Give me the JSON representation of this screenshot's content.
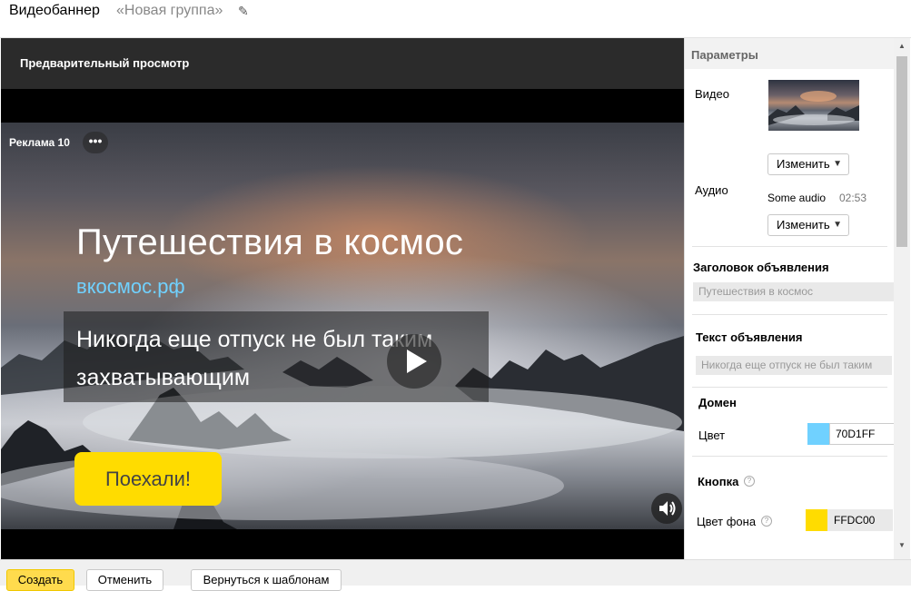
{
  "header": {
    "title": "Видеобаннер",
    "group": "«Новая группа»"
  },
  "preview": {
    "label": "Предварительный просмотр",
    "ad_label": "Реклама 10",
    "dots": "•••",
    "headline": "Путешествия в космос",
    "domain": "вкосмос.рф",
    "body": "Никогда еще отпуск не был таким захватывающим",
    "cta": "Поехали!"
  },
  "panel": {
    "title": "Параметры",
    "video_label": "Видео",
    "change_label": "Изменить",
    "audio_label": "Аудио",
    "audio_name": "Some audio",
    "audio_time": "02:53",
    "headline_label": "Заголовок объявления",
    "headline_value": "Путешествия в космос",
    "text_label": "Текст объявления",
    "text_value": "Никогда еще отпуск не был таким",
    "domain_section": "Домен",
    "color_label": "Цвет",
    "domain_color": "70D1FF",
    "button_section": "Кнопка",
    "bg_color_label": "Цвет фона",
    "button_color": "FFDC00",
    "help": "?"
  },
  "colors": {
    "domain_swatch": "#70D1FF",
    "button_swatch": "#FFDC00"
  },
  "footer": {
    "create": "Создать",
    "cancel": "Отменить",
    "back": "Вернуться к шаблонам"
  }
}
